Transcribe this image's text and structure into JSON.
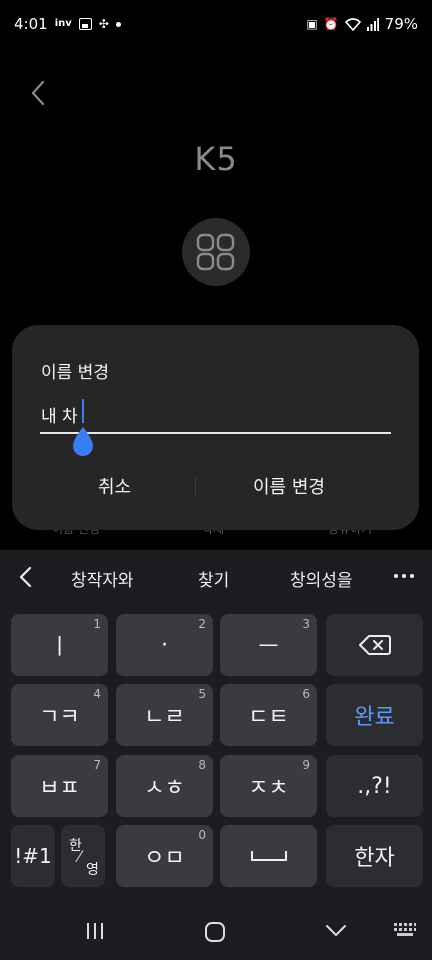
{
  "status_bar": {
    "time": "4:01",
    "left_icons": [
      "inv-icon",
      "gallery-icon",
      "pinwheel-icon",
      "dot-icon"
    ],
    "right_icons": [
      "battery-saver-icon",
      "alarm-icon",
      "wifi-icon",
      "signal-icon"
    ],
    "battery": "79%"
  },
  "page": {
    "car_name": "K5",
    "background_labels": [
      "이름 변경",
      "삭제",
      "공유하기"
    ]
  },
  "dialog": {
    "title": "이름 변경",
    "input_value": "내 차",
    "cancel_label": "취소",
    "confirm_label": "이름 변경"
  },
  "keyboard": {
    "suggestions": [
      "창작자와",
      "찾기",
      "창의성을"
    ],
    "keys": {
      "r1": [
        {
          "label": "ㅣ",
          "hint": "1"
        },
        {
          "label": "·",
          "hint": "2"
        },
        {
          "label": "ㅡ",
          "hint": "3"
        },
        {
          "label": "",
          "icon": "backspace-icon"
        }
      ],
      "r2": [
        {
          "label": "ㄱㅋ",
          "hint": "4"
        },
        {
          "label": "ㄴㄹ",
          "hint": "5"
        },
        {
          "label": "ㄷㅌ",
          "hint": "6"
        },
        {
          "label": "완료"
        }
      ],
      "r3": [
        {
          "label": "ㅂㅍ",
          "hint": "7"
        },
        {
          "label": "ㅅㅎ",
          "hint": "8"
        },
        {
          "label": "ㅈㅊ",
          "hint": "9"
        },
        {
          "label": ".,?!"
        }
      ],
      "r4": [
        {
          "label": "!#1"
        },
        {
          "label": "한",
          "sub": "영"
        },
        {
          "label": "ㅇㅁ",
          "hint": "0"
        },
        {
          "label": "",
          "icon": "space-icon"
        },
        {
          "label": "한자"
        }
      ]
    },
    "accent_color": "#5a9cf8"
  },
  "navbar": {
    "icons": [
      "recent-apps-icon",
      "home-icon",
      "hide-keyboard-icon",
      "keyboard-switch-icon"
    ]
  }
}
